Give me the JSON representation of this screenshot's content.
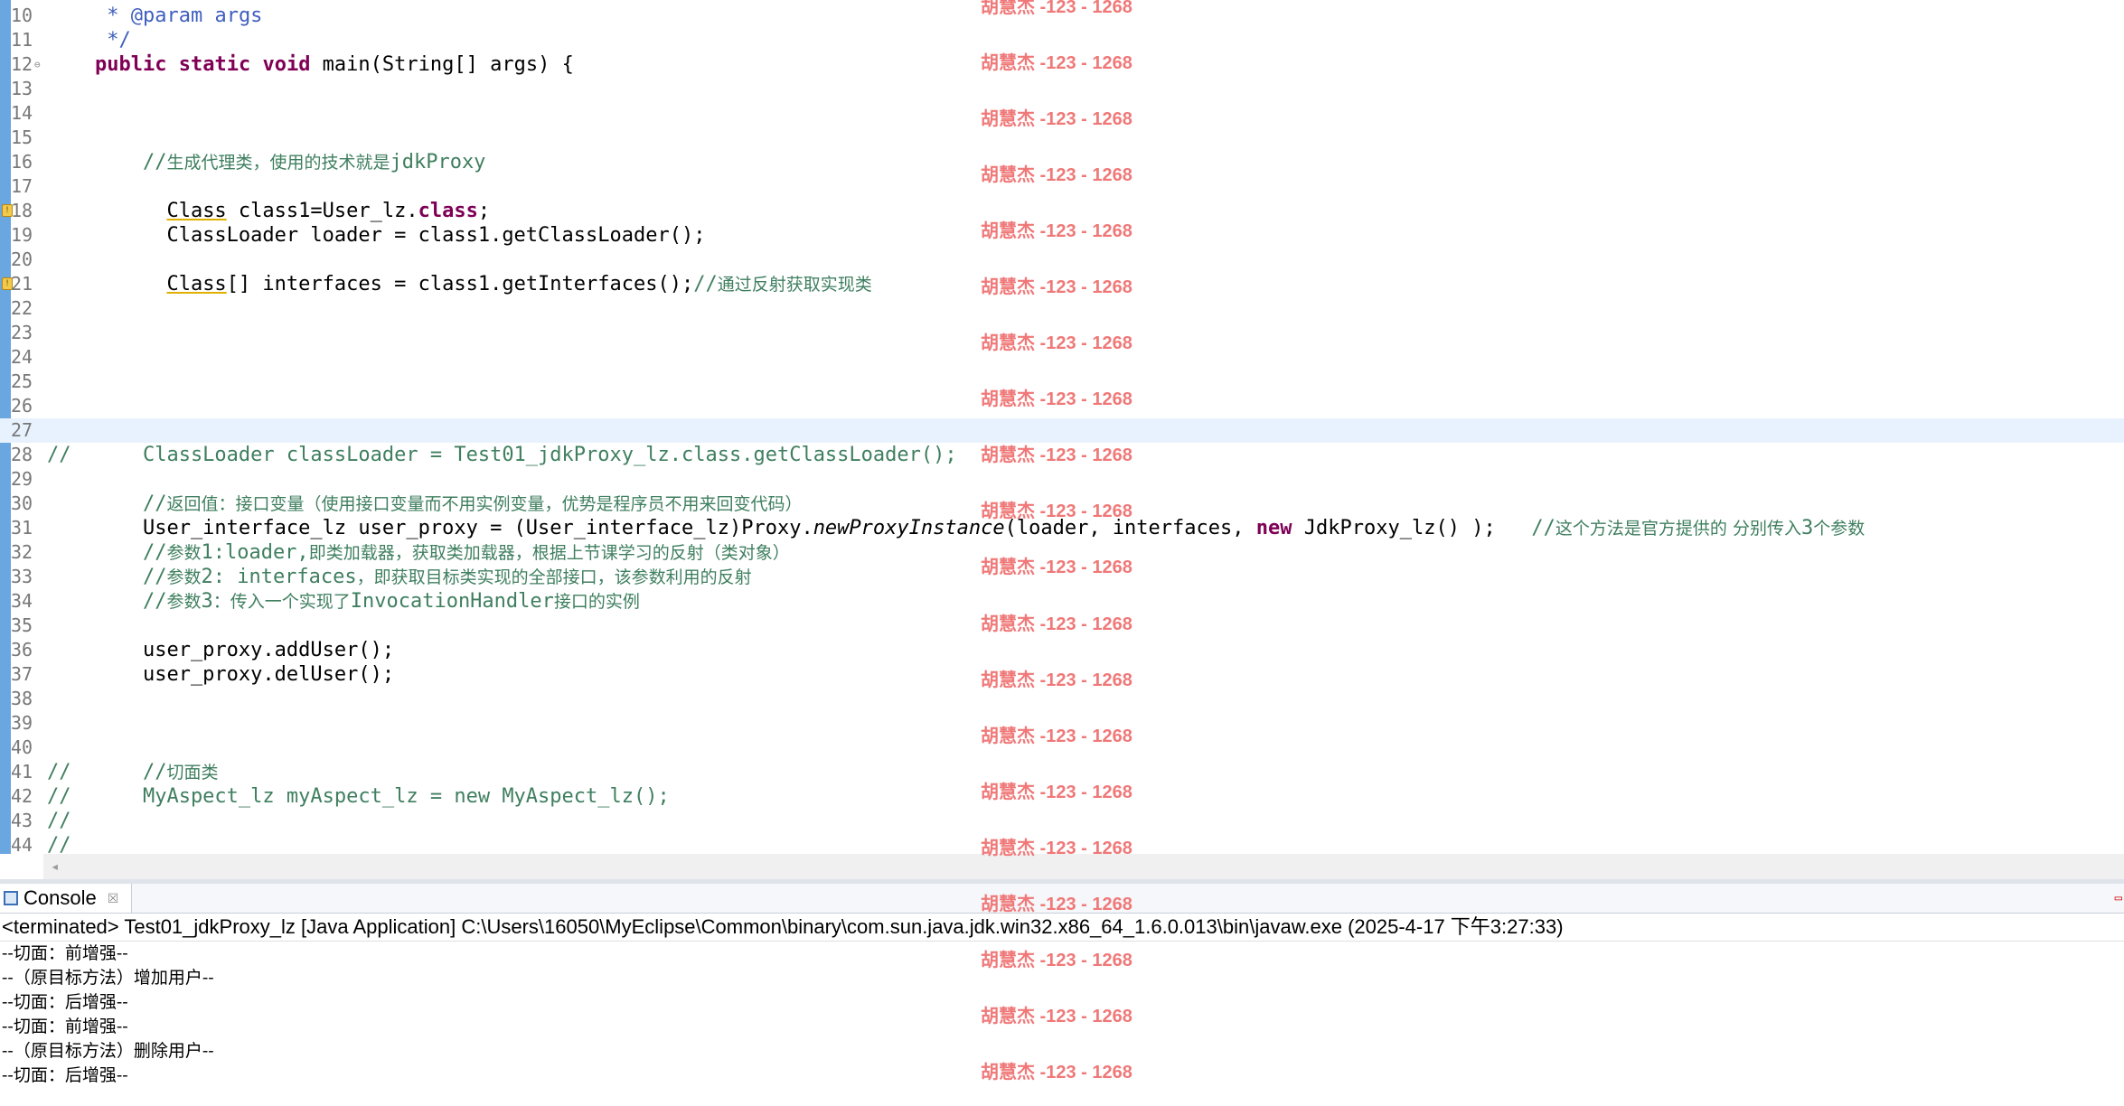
{
  "editor": {
    "lines": [
      {
        "n": "10",
        "segs": [
          {
            "t": "     * ",
            "c": "jd"
          },
          {
            "t": "@param",
            "c": "jd"
          },
          {
            "t": " args",
            "c": "jd"
          }
        ]
      },
      {
        "n": "11",
        "segs": [
          {
            "t": "     */",
            "c": "jd"
          }
        ]
      },
      {
        "n": "12",
        "fold": true,
        "segs": [
          {
            "t": "    ",
            "c": ""
          },
          {
            "t": "public",
            "c": "kw"
          },
          {
            "t": " ",
            "c": ""
          },
          {
            "t": "static",
            "c": "kw"
          },
          {
            "t": " ",
            "c": ""
          },
          {
            "t": "void",
            "c": "kw"
          },
          {
            "t": " main(String[] args) {",
            "c": ""
          }
        ]
      },
      {
        "n": "13",
        "segs": []
      },
      {
        "n": "14",
        "segs": []
      },
      {
        "n": "15",
        "segs": []
      },
      {
        "n": "16",
        "segs": [
          {
            "t": "        //",
            "c": "cm"
          },
          {
            "t": "生成代理类，使用的技术就是",
            "c": "cm cn"
          },
          {
            "t": "jdkProxy",
            "c": "cm"
          }
        ]
      },
      {
        "n": "17",
        "segs": []
      },
      {
        "n": "18",
        "warn": true,
        "segs": [
          {
            "t": "          ",
            "c": ""
          },
          {
            "t": "Class",
            "c": "under"
          },
          {
            "t": " class1=User_lz.",
            "c": ""
          },
          {
            "t": "class",
            "c": "kw"
          },
          {
            "t": ";",
            "c": ""
          }
        ]
      },
      {
        "n": "19",
        "segs": [
          {
            "t": "          ClassLoader loader = class1.getClassLoader();",
            "c": ""
          }
        ]
      },
      {
        "n": "20",
        "segs": []
      },
      {
        "n": "21",
        "warn": true,
        "segs": [
          {
            "t": "          ",
            "c": ""
          },
          {
            "t": "Class",
            "c": "under"
          },
          {
            "t": "[] interfaces = class1.getInterfaces();",
            "c": ""
          },
          {
            "t": "//",
            "c": "cm"
          },
          {
            "t": "通过反射获取实现类",
            "c": "cm cn"
          }
        ]
      },
      {
        "n": "22",
        "segs": []
      },
      {
        "n": "23",
        "segs": []
      },
      {
        "n": "24",
        "segs": []
      },
      {
        "n": "25",
        "segs": []
      },
      {
        "n": "26",
        "segs": []
      },
      {
        "n": "27",
        "current": true,
        "segs": []
      },
      {
        "n": "28",
        "segs": [
          {
            "t": "//      ClassLoader classLoader = Test01_jdkProxy_lz.class.getClassLoader();",
            "c": "cm"
          }
        ]
      },
      {
        "n": "29",
        "segs": []
      },
      {
        "n": "30",
        "segs": [
          {
            "t": "        //",
            "c": "cm"
          },
          {
            "t": "返回值：接口变量（使用接口变量而不用实例变量，优势是程序员不用来回变代码）",
            "c": "cm cn"
          }
        ]
      },
      {
        "n": "31",
        "segs": [
          {
            "t": "        User_interface_lz user_proxy = (User_interface_lz)Proxy.",
            "c": ""
          },
          {
            "t": "newProxyInstance",
            "c": "it"
          },
          {
            "t": "(loader, interfaces, ",
            "c": ""
          },
          {
            "t": "new",
            "c": "kw"
          },
          {
            "t": " JdkProxy_lz() );   ",
            "c": ""
          },
          {
            "t": "//",
            "c": "cm"
          },
          {
            "t": "这个方法是官方提供的 分别传入",
            "c": "cm cn"
          },
          {
            "t": "3",
            "c": "cm"
          },
          {
            "t": "个参数",
            "c": "cm cn"
          }
        ]
      },
      {
        "n": "32",
        "segs": [
          {
            "t": "        //",
            "c": "cm"
          },
          {
            "t": "参数",
            "c": "cm cn"
          },
          {
            "t": "1:loader,",
            "c": "cm"
          },
          {
            "t": "即类加载器，获取类加载器，根据上节课学习的反射（类对象）",
            "c": "cm cn"
          }
        ]
      },
      {
        "n": "33",
        "segs": [
          {
            "t": "        //",
            "c": "cm"
          },
          {
            "t": "参数",
            "c": "cm cn"
          },
          {
            "t": "2: interfaces",
            "c": "cm"
          },
          {
            "t": "，即获取目标类实现的全部接口，该参数利用的反射",
            "c": "cm cn"
          }
        ]
      },
      {
        "n": "34",
        "segs": [
          {
            "t": "        //",
            "c": "cm"
          },
          {
            "t": "参数",
            "c": "cm cn"
          },
          {
            "t": "3",
            "c": "cm"
          },
          {
            "t": "：传入一个实现了",
            "c": "cm cn"
          },
          {
            "t": "InvocationHandler",
            "c": "cm"
          },
          {
            "t": "接口的实例",
            "c": "cm cn"
          }
        ]
      },
      {
        "n": "35",
        "segs": []
      },
      {
        "n": "36",
        "segs": [
          {
            "t": "        user_proxy.addUser();",
            "c": ""
          }
        ]
      },
      {
        "n": "37",
        "segs": [
          {
            "t": "        user_proxy.delUser();",
            "c": ""
          }
        ]
      },
      {
        "n": "38",
        "segs": []
      },
      {
        "n": "39",
        "segs": []
      },
      {
        "n": "40",
        "segs": []
      },
      {
        "n": "41",
        "segs": [
          {
            "t": "//      //",
            "c": "cm"
          },
          {
            "t": "切面类",
            "c": "cm cn"
          }
        ]
      },
      {
        "n": "42",
        "segs": [
          {
            "t": "//      MyAspect_lz myAspect_lz = new MyAspect_lz();",
            "c": "cm"
          }
        ]
      },
      {
        "n": "43",
        "segs": [
          {
            "t": "//",
            "c": "cm"
          }
        ]
      },
      {
        "n": "44",
        "segs": [
          {
            "t": "//",
            "c": "cm"
          }
        ]
      }
    ]
  },
  "watermark": {
    "text": "胡慧杰 -123 - 1268",
    "count": 20
  },
  "scrollbar": {
    "left_arrow": "◂"
  },
  "console": {
    "tab_label": "Console",
    "tab_close": "☒",
    "minimize": "▭",
    "header": "<terminated> Test01_jdkProxy_lz [Java Application] C:\\Users\\16050\\MyEclipse\\Common\\binary\\com.sun.java.jdk.win32.x86_64_1.6.0.013\\bin\\javaw.exe (2025-4-17 下午3:27:33)",
    "output": [
      "--切面：前增强--",
      "--（原目标方法）增加用户--",
      "--切面：后增强--",
      "--切面：前增强--",
      "--（原目标方法）删除用户--",
      "--切面：后增强--"
    ]
  },
  "colors": {
    "keyword": "#7f0055",
    "comment": "#3f7f5f",
    "javadoc": "#3f5fbf",
    "current_line": "#e8f2fe",
    "watermark": "#f07878",
    "left_bar": "#6aa6e0"
  }
}
